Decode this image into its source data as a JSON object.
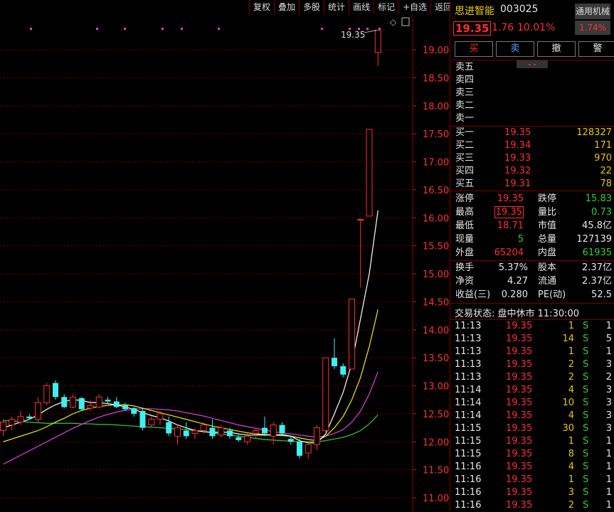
{
  "toolbar": {
    "buttons": [
      "复权",
      "叠加",
      "多股",
      "统计",
      "画线",
      "标记",
      "+自选",
      "返回"
    ]
  },
  "chart": {
    "y_ticks": [
      "19.00",
      "18.50",
      "18.00",
      "17.50",
      "17.00",
      "16.50",
      "16.00",
      "15.50",
      "15.00",
      "14.50",
      "14.00",
      "13.50",
      "13.00",
      "12.50",
      "12.00",
      "11.50",
      "11.00"
    ],
    "high_label": "19.35"
  },
  "chart_data": {
    "type": "candlestick",
    "ylim": [
      11.0,
      19.5
    ],
    "ma_colors": {
      "ma5": "#ffffff",
      "ma10": "#f0f000",
      "ma20": "#e040e0",
      "ma60": "#30d030"
    },
    "up_color": "#ff3030",
    "down_color": "#40f0f0",
    "candles": [
      {
        "o": 12.2,
        "h": 12.4,
        "l": 12.1,
        "c": 12.35
      },
      {
        "o": 12.3,
        "h": 12.45,
        "l": 12.2,
        "c": 12.4
      },
      {
        "o": 12.35,
        "h": 12.55,
        "l": 12.3,
        "c": 12.45
      },
      {
        "o": 12.45,
        "h": 12.5,
        "l": 12.4,
        "c": 12.42
      },
      {
        "o": 12.4,
        "h": 12.8,
        "l": 12.35,
        "c": 12.7
      },
      {
        "o": 12.7,
        "h": 13.05,
        "l": 12.65,
        "c": 13.0
      },
      {
        "o": 13.05,
        "h": 13.1,
        "l": 12.75,
        "c": 12.8
      },
      {
        "o": 12.8,
        "h": 12.85,
        "l": 12.6,
        "c": 12.62
      },
      {
        "o": 12.62,
        "h": 12.85,
        "l": 12.6,
        "c": 12.8
      },
      {
        "o": 12.78,
        "h": 12.8,
        "l": 12.55,
        "c": 12.58
      },
      {
        "o": 12.6,
        "h": 12.75,
        "l": 12.55,
        "c": 12.65
      },
      {
        "o": 12.62,
        "h": 12.85,
        "l": 12.6,
        "c": 12.8
      },
      {
        "o": 12.75,
        "h": 12.8,
        "l": 12.68,
        "c": 12.72
      },
      {
        "o": 12.72,
        "h": 12.8,
        "l": 12.6,
        "c": 12.62
      },
      {
        "o": 12.65,
        "h": 12.7,
        "l": 12.55,
        "c": 12.58
      },
      {
        "o": 12.6,
        "h": 12.62,
        "l": 12.45,
        "c": 12.5
      },
      {
        "o": 12.55,
        "h": 12.6,
        "l": 12.2,
        "c": 12.25
      },
      {
        "o": 12.3,
        "h": 12.45,
        "l": 12.25,
        "c": 12.4
      },
      {
        "o": 12.4,
        "h": 12.55,
        "l": 12.3,
        "c": 12.5
      },
      {
        "o": 12.35,
        "h": 12.45,
        "l": 12.1,
        "c": 12.15
      },
      {
        "o": 12.1,
        "h": 12.3,
        "l": 11.95,
        "c": 12.25
      },
      {
        "o": 12.2,
        "h": 12.35,
        "l": 12.05,
        "c": 12.1
      },
      {
        "o": 12.15,
        "h": 12.25,
        "l": 12.05,
        "c": 12.2
      },
      {
        "o": 12.2,
        "h": 12.35,
        "l": 12.15,
        "c": 12.3
      },
      {
        "o": 12.25,
        "h": 12.4,
        "l": 12.05,
        "c": 12.1
      },
      {
        "o": 12.12,
        "h": 12.3,
        "l": 12.08,
        "c": 12.25
      },
      {
        "o": 12.2,
        "h": 12.25,
        "l": 12.05,
        "c": 12.1
      },
      {
        "o": 12.08,
        "h": 12.12,
        "l": 12.0,
        "c": 12.03
      },
      {
        "o": 12.0,
        "h": 12.15,
        "l": 11.95,
        "c": 12.1
      },
      {
        "o": 12.15,
        "h": 12.25,
        "l": 12.05,
        "c": 12.2
      },
      {
        "o": 12.25,
        "h": 12.45,
        "l": 12.1,
        "c": 12.15
      },
      {
        "o": 12.1,
        "h": 12.35,
        "l": 11.95,
        "c": 12.3
      },
      {
        "o": 12.3,
        "h": 12.35,
        "l": 12.1,
        "c": 12.15
      },
      {
        "o": 12.05,
        "h": 12.1,
        "l": 11.95,
        "c": 12.0
      },
      {
        "o": 12.0,
        "h": 12.05,
        "l": 11.7,
        "c": 11.75
      },
      {
        "o": 11.8,
        "h": 12.0,
        "l": 11.7,
        "c": 11.95
      },
      {
        "o": 11.95,
        "h": 12.3,
        "l": 11.85,
        "c": 12.25
      },
      {
        "o": 12.2,
        "h": 13.5,
        "l": 12.15,
        "c": 13.5
      },
      {
        "o": 13.5,
        "h": 13.85,
        "l": 13.3,
        "c": 13.35
      },
      {
        "o": 13.35,
        "h": 13.4,
        "l": 13.15,
        "c": 13.2
      },
      {
        "o": 13.3,
        "h": 14.55,
        "l": 13.3,
        "c": 14.55
      },
      {
        "o": 15.97,
        "h": 15.97,
        "l": 14.75,
        "c": 15.97
      },
      {
        "o": 16.03,
        "h": 17.58,
        "l": 16.03,
        "c": 17.58
      },
      {
        "o": 18.95,
        "h": 19.35,
        "l": 18.71,
        "c": 19.35
      }
    ],
    "ma5": [
      12.25,
      12.3,
      12.35,
      12.4,
      12.48,
      12.58,
      12.66,
      12.72,
      12.75,
      12.74,
      12.7,
      12.7,
      12.68,
      12.66,
      12.62,
      12.58,
      12.52,
      12.47,
      12.43,
      12.37,
      12.3,
      12.25,
      12.2,
      12.18,
      12.17,
      12.17,
      12.17,
      12.14,
      12.12,
      12.12,
      12.12,
      12.12,
      12.13,
      12.1,
      12.02,
      11.98,
      11.98,
      12.14,
      12.5,
      12.88,
      13.4,
      14.2,
      15.0,
      16.13
    ],
    "ma10": [
      12.0,
      12.05,
      12.1,
      12.15,
      12.2,
      12.27,
      12.35,
      12.42,
      12.5,
      12.56,
      12.6,
      12.63,
      12.65,
      12.66,
      12.66,
      12.64,
      12.6,
      12.56,
      12.52,
      12.48,
      12.44,
      12.4,
      12.36,
      12.32,
      12.28,
      12.25,
      12.22,
      12.19,
      12.16,
      12.14,
      12.13,
      12.12,
      12.11,
      12.1,
      12.07,
      12.04,
      12.02,
      12.1,
      12.25,
      12.45,
      12.75,
      13.15,
      13.7,
      14.36
    ],
    "ma20": [
      11.6,
      11.68,
      11.76,
      11.84,
      11.92,
      12.0,
      12.08,
      12.16,
      12.24,
      12.31,
      12.38,
      12.44,
      12.49,
      12.53,
      12.56,
      12.58,
      12.59,
      12.59,
      12.58,
      12.57,
      12.55,
      12.52,
      12.49,
      12.46,
      12.42,
      12.38,
      12.34,
      12.3,
      12.27,
      12.24,
      12.21,
      12.18,
      12.16,
      12.14,
      12.12,
      12.1,
      12.08,
      12.1,
      12.15,
      12.22,
      12.35,
      12.55,
      12.85,
      13.25
    ],
    "ma60": [
      12.38,
      12.37,
      12.36,
      12.35,
      12.34,
      12.33,
      12.33,
      12.33,
      12.33,
      12.32,
      12.32,
      12.31,
      12.31,
      12.3,
      12.29,
      12.28,
      12.27,
      12.26,
      12.25,
      12.24,
      12.23,
      12.22,
      12.2,
      12.18,
      12.16,
      12.14,
      12.12,
      12.1,
      12.08,
      12.06,
      12.04,
      12.03,
      12.02,
      12.01,
      12.0,
      12.0,
      12.0,
      12.02,
      12.05,
      12.08,
      12.13,
      12.2,
      12.32,
      12.48
    ]
  },
  "stock": {
    "name": "思进智能",
    "code": "003025",
    "industry": "通用机械",
    "industry_pct": "1.74%",
    "price": "19.35",
    "change": "1.76",
    "change_pct": "10.01%"
  },
  "actions": {
    "buy": "买",
    "sell": "卖",
    "cancel": "撤",
    "alert": "警"
  },
  "asks": [
    {
      "label": "卖五",
      "price": "",
      "vol": ""
    },
    {
      "label": "卖四",
      "price": "",
      "vol": ""
    },
    {
      "label": "卖三",
      "price": "",
      "vol": ""
    },
    {
      "label": "卖二",
      "price": "",
      "vol": ""
    },
    {
      "label": "卖一",
      "price": "",
      "vol": ""
    }
  ],
  "bids": [
    {
      "label": "买一",
      "price": "19.35",
      "vol": "128327"
    },
    {
      "label": "买二",
      "price": "19.34",
      "vol": "171"
    },
    {
      "label": "买三",
      "price": "19.33",
      "vol": "970"
    },
    {
      "label": "买四",
      "price": "19.32",
      "vol": "22"
    },
    {
      "label": "买五",
      "price": "19.31",
      "vol": "78"
    }
  ],
  "stats1": [
    {
      "l1": "涨停",
      "v1": "19.35",
      "c1": "red",
      "l2": "跌停",
      "v2": "15.83",
      "c2": "green"
    },
    {
      "l1": "最高",
      "v1": "19.35",
      "c1": "red",
      "l2": "量比",
      "v2": "0.73",
      "c2": "green"
    },
    {
      "l1": "最低",
      "v1": "18.71",
      "c1": "red",
      "l2": "市值",
      "v2": "45.8亿",
      "c2": "white"
    },
    {
      "l1": "现量",
      "v1": "5",
      "c1": "green",
      "l2": "总量",
      "v2": "127139",
      "c2": "white"
    },
    {
      "l1": "外盘",
      "v1": "65204",
      "c1": "red",
      "l2": "内盘",
      "v2": "61935",
      "c2": "green"
    }
  ],
  "stats2": [
    {
      "l1": "换手",
      "v1": "5.37%",
      "l2": "股本",
      "v2": "2.37亿"
    },
    {
      "l1": "净资",
      "v1": "4.27",
      "l2": "流通",
      "v2": "2.37亿"
    },
    {
      "l1": "收益(三)",
      "v1": "0.280",
      "l2": "PE(动)",
      "v2": "52.5"
    }
  ],
  "trade_status": "交易状态: 盘中休市 11:30:00",
  "ticks": [
    {
      "t": "11:13",
      "p": "19.35",
      "v": "1",
      "s": "S",
      "n": "1"
    },
    {
      "t": "11:13",
      "p": "19.35",
      "v": "14",
      "s": "S",
      "n": "5"
    },
    {
      "t": "11:13",
      "p": "19.35",
      "v": "1",
      "s": "S",
      "n": "1"
    },
    {
      "t": "11:13",
      "p": "19.35",
      "v": "2",
      "s": "S",
      "n": "3"
    },
    {
      "t": "11:13",
      "p": "19.35",
      "v": "2",
      "s": "S",
      "n": "2"
    },
    {
      "t": "11:14",
      "p": "19.35",
      "v": "4",
      "s": "S",
      "n": "3"
    },
    {
      "t": "11:14",
      "p": "19.35",
      "v": "10",
      "s": "S",
      "n": "3"
    },
    {
      "t": "11:14",
      "p": "19.35",
      "v": "4",
      "s": "S",
      "n": "3"
    },
    {
      "t": "11:15",
      "p": "19.35",
      "v": "30",
      "s": "S",
      "n": "3"
    },
    {
      "t": "11:15",
      "p": "19.35",
      "v": "1",
      "s": "S",
      "n": "1"
    },
    {
      "t": "11:15",
      "p": "19.35",
      "v": "8",
      "s": "S",
      "n": "1"
    },
    {
      "t": "11:16",
      "p": "19.35",
      "v": "4",
      "s": "S",
      "n": "1"
    },
    {
      "t": "11:16",
      "p": "19.35",
      "v": "1",
      "s": "S",
      "n": "1"
    },
    {
      "t": "11:16",
      "p": "19.35",
      "v": "3",
      "s": "S",
      "n": "1"
    },
    {
      "t": "11:16",
      "p": "19.35",
      "v": "2",
      "s": "S",
      "n": "1"
    }
  ]
}
